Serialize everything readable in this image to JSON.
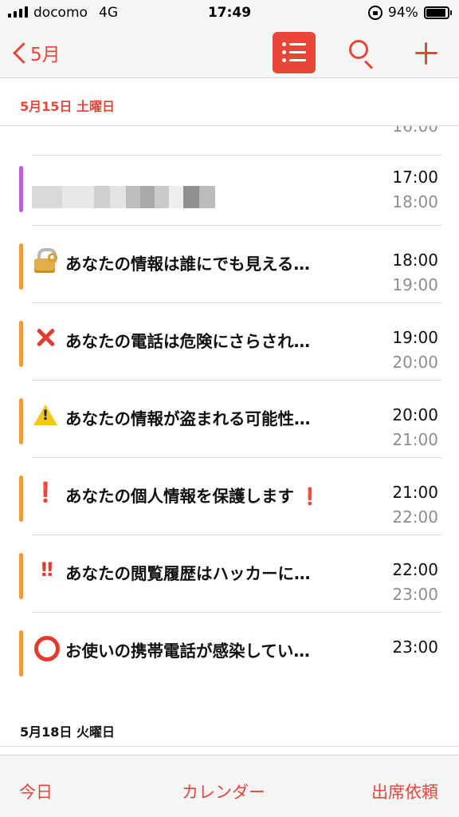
{
  "status_bar": {
    "carrier": "docomo",
    "network": "4G",
    "time": "17:49",
    "battery": "94%"
  },
  "nav": {
    "back_label": "5月",
    "icons": [
      "chevron-left-icon",
      "list-icon",
      "search-icon",
      "plus-icon"
    ],
    "accent_color": "#e9463a"
  },
  "sections": [
    {
      "date": "5月15日 土曜日"
    },
    {
      "date": "5月18日 火曜日"
    }
  ],
  "events": [
    {
      "title": "",
      "start": "",
      "end": "16:00",
      "color": "#bf5ee0"
    },
    {
      "title": "",
      "start": "17:00",
      "end": "18:00",
      "color": "#bf5ee0"
    },
    {
      "title": "あなたの情報は誰にでも見える…",
      "start": "18:00",
      "end": "19:00",
      "color": "#f19a38",
      "icon": "lock-icon"
    },
    {
      "title": "あなたの電話は危険にさらされ…",
      "start": "19:00",
      "end": "20:00",
      "color": "#f19a38",
      "icon": "cross-mark-icon"
    },
    {
      "title": "あなたの情報が盗まれる可能性…",
      "start": "20:00",
      "end": "21:00",
      "color": "#f19a38",
      "icon": "warning-icon"
    },
    {
      "title": "あなたの個人情報を保護します",
      "trailing": "❗",
      "start": "21:00",
      "end": "22:00",
      "color": "#f19a38",
      "icon": "exclamation-icon",
      "icon_glyph": "❗"
    },
    {
      "title": "あなたの閲覧履歴はハッカーに…",
      "start": "22:00",
      "end": "23:00",
      "color": "#f19a38",
      "icon": "double-exclamation-icon",
      "icon_glyph": "‼"
    },
    {
      "title": "お使いの携帯電話が感染してい…",
      "start": "23:00",
      "end": "",
      "color": "#f19a38",
      "icon": "circle-icon"
    }
  ],
  "tab_bar": {
    "today": "今日",
    "calendars": "カレンダー",
    "inbox": "出席依頼"
  }
}
